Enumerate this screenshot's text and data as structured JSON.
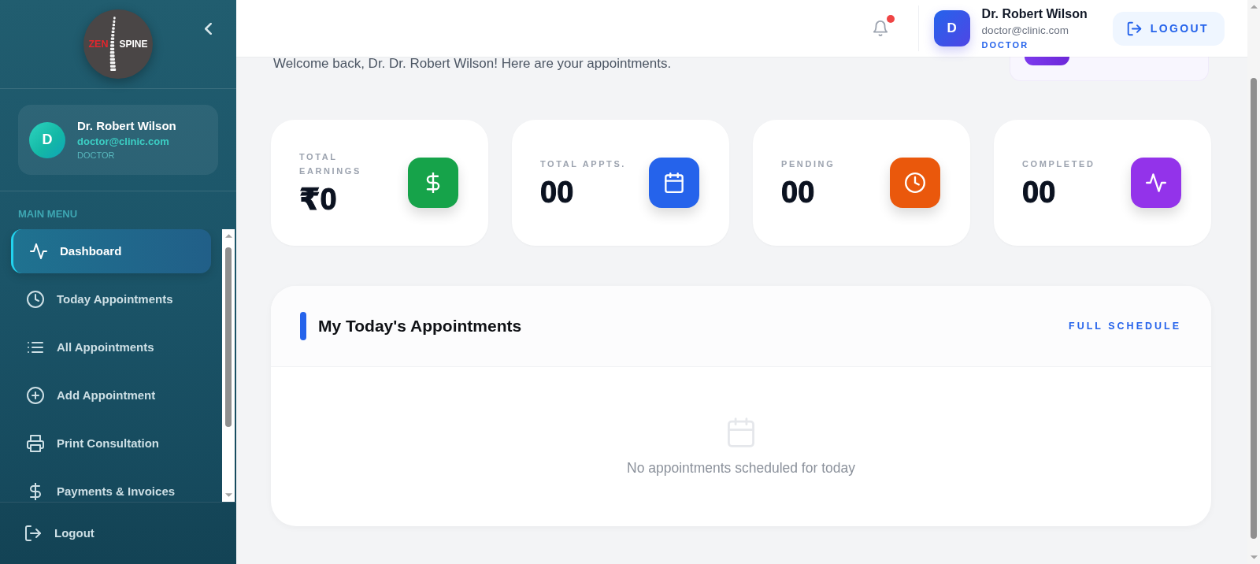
{
  "sidebar": {
    "logo": {
      "word_1": "ZEN",
      "word_2": "SPINE"
    },
    "profile": {
      "initial": "D",
      "name": "Dr. Robert Wilson",
      "email": "doctor@clinic.com",
      "role": "DOCTOR"
    },
    "menu_title": "MAIN MENU",
    "menu": [
      {
        "label": "Dashboard",
        "selected": true
      },
      {
        "label": "Today Appointments",
        "selected": false
      },
      {
        "label": "All Appointments",
        "selected": false
      },
      {
        "label": "Add Appointment",
        "selected": false
      },
      {
        "label": "Print Consultation",
        "selected": false
      },
      {
        "label": "Payments & Invoices",
        "selected": false
      }
    ],
    "logout": "Logout"
  },
  "header": {
    "notification": {
      "unread": true
    },
    "user": {
      "initial": "D",
      "name": "Dr. Robert Wilson",
      "email": "doctor@clinic.com",
      "role": "DOCTOR"
    },
    "logout_button": "LOGOUT"
  },
  "welcome": "Welcome back, Dr. Dr. Robert Wilson! Here are your appointments.",
  "stats": [
    {
      "label": "TOTAL EARNINGS",
      "value": "₹0",
      "color": "#16a34a"
    },
    {
      "label": "TOTAL APPTS.",
      "value": "00",
      "color": "#2563eb"
    },
    {
      "label": "PENDING",
      "value": "00",
      "color": "#ea580c"
    },
    {
      "label": "COMPLETED",
      "value": "00",
      "color": "#9333ea"
    }
  ],
  "appointments": {
    "title": "My Today's Appointments",
    "link": "FULL SCHEDULE",
    "empty_message": "No appointments scheduled for today"
  }
}
